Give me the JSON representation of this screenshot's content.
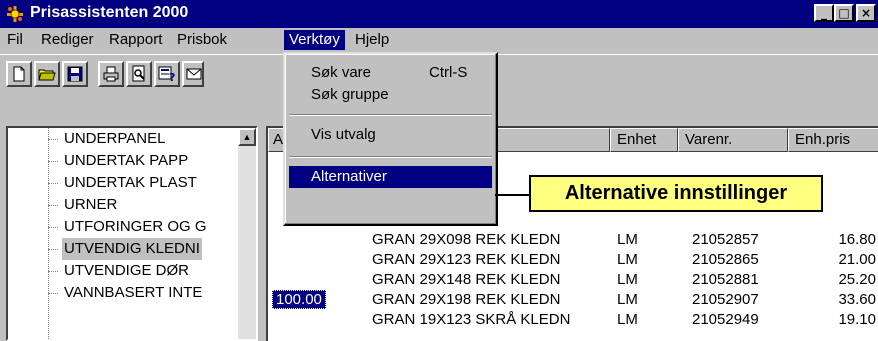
{
  "window": {
    "title": "Prisassistenten 2000",
    "controls": [
      "minimize",
      "maximize",
      "close"
    ]
  },
  "menubar": [
    {
      "label": "Fil",
      "active": false
    },
    {
      "label": "Rediger",
      "active": false
    },
    {
      "label": "Rapport",
      "active": false
    },
    {
      "label": "Prisbok",
      "active": false
    },
    {
      "label": "Verktøy",
      "active": true
    },
    {
      "label": "Hjelp",
      "active": false
    }
  ],
  "toolbar": {
    "icons": [
      "new-file-icon",
      "open-folder-icon",
      "save-disk-icon",
      "print-icon",
      "print-preview-icon",
      "help-icon",
      "mail-icon"
    ]
  },
  "verktoy_menu": {
    "items": [
      {
        "label": "Søk vare",
        "shortcut": "Ctrl-S"
      },
      {
        "label": "Søk gruppe",
        "shortcut": ""
      },
      {
        "label": "Vis utvalg",
        "shortcut": ""
      },
      {
        "label": "Alternativer",
        "shortcut": "",
        "highlighted": true
      }
    ]
  },
  "callout": {
    "text": "Alternative innstillinger"
  },
  "tree": {
    "items": [
      {
        "label": "UNDERPANEL",
        "selected": false
      },
      {
        "label": "UNDERTAK PAPP",
        "selected": false
      },
      {
        "label": "UNDERTAK PLAST",
        "selected": false
      },
      {
        "label": "URNER",
        "selected": false
      },
      {
        "label": "UTFORINGER OG G",
        "selected": false
      },
      {
        "label": "UTVENDIG KLEDNI",
        "selected": true
      },
      {
        "label": "UTVENDIGE DØR",
        "selected": false
      },
      {
        "label": "VANNBASERT INTE",
        "selected": false
      }
    ]
  },
  "grid": {
    "columns": {
      "first": "A",
      "enhet": "Enhet",
      "varenr": "Varenr.",
      "enhpris": "Enh.pris"
    },
    "rows": [
      {
        "qty": "",
        "name": "GRAN 29X098 REK KLEDN",
        "enhet": "LM",
        "varenr": "21052857",
        "pris": "16.80"
      },
      {
        "qty": "",
        "name": "GRAN 29X123 REK KLEDN",
        "enhet": "LM",
        "varenr": "21052865",
        "pris": "21.00"
      },
      {
        "qty": "",
        "name": "GRAN 29X148 REK KLEDN",
        "enhet": "LM",
        "varenr": "21052881",
        "pris": "25.20"
      },
      {
        "qty": "100.00",
        "name": "GRAN 29X198 REK KLEDN",
        "enhet": "LM",
        "varenr": "21052907",
        "pris": "33.60"
      },
      {
        "qty": "",
        "name": "GRAN 19X123 SKRÅ KLEDN",
        "enhet": "LM",
        "varenr": "21052949",
        "pris": "19.10"
      }
    ]
  }
}
